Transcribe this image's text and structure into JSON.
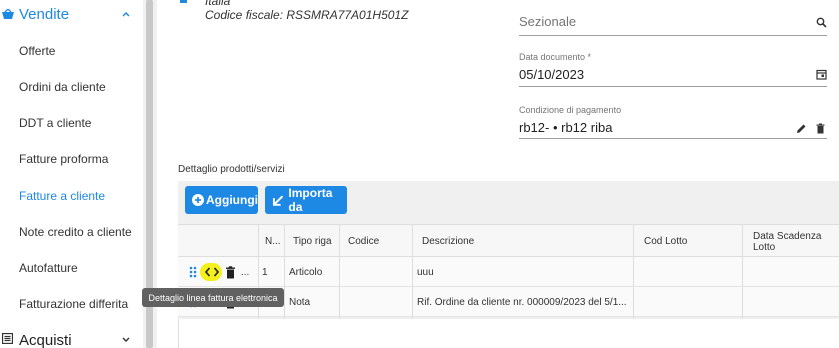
{
  "sidebar": {
    "section_title": "Vendite",
    "items": [
      {
        "label": "Offerte"
      },
      {
        "label": "Ordini da cliente"
      },
      {
        "label": "DDT a cliente"
      },
      {
        "label": "Fatture proforma"
      },
      {
        "label": "Fatture a cliente",
        "active": true
      },
      {
        "label": "Note credito a cliente"
      },
      {
        "label": "Autofatture"
      },
      {
        "label": "Fatturazione differita"
      }
    ],
    "footer_title": "Acquisti"
  },
  "customer": {
    "country": "Italia",
    "tax_code": "Codice fiscale: RSSMRA77A01H501Z"
  },
  "fields": {
    "sezionale": {
      "placeholder": "Sezionale",
      "icon": "search-icon"
    },
    "data_documento": {
      "label": "Data documento *",
      "value": "05/10/2023",
      "icon": "calendar-icon"
    },
    "condizione_pagamento": {
      "label": "Condizione di pagamento",
      "value": "rb12- • rb12 riba"
    }
  },
  "products": {
    "section_label": "Dettaglio prodotti/servizi",
    "add_button": "Aggiungi",
    "import_button": "Importa da",
    "columns": [
      "N...",
      "Tipo riga",
      "Codice",
      "Descrizione",
      "Cod Lotto",
      "Data Scadenza Lotto"
    ],
    "rows": [
      {
        "n": "1",
        "tipo": "Articolo",
        "codice": "",
        "descrizione": "uuu",
        "lotto": "",
        "scadenza": ""
      },
      {
        "n": "",
        "tipo": "Nota",
        "codice": "",
        "descrizione": "Rif. Ordine da cliente nr. 000009/2023 del 5/1...",
        "lotto": "",
        "scadenza": ""
      }
    ],
    "row_more": "...",
    "tooltip": "Dettaglio linea fattura elettronica"
  },
  "colors": {
    "accent": "#1e88e5",
    "highlight": "#f4f01c",
    "tooltip_bg": "#616161"
  }
}
